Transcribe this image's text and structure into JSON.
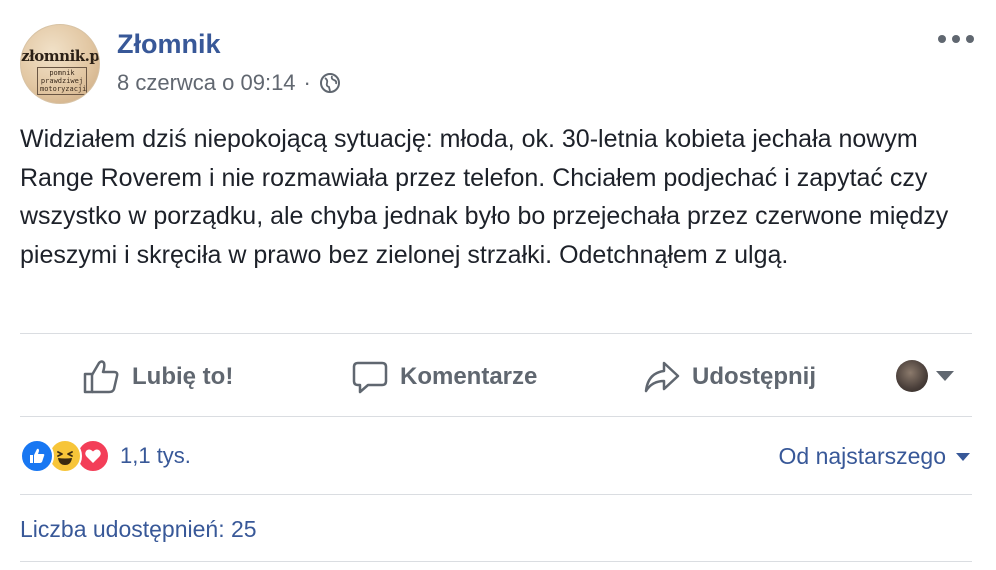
{
  "post": {
    "author": "Złomnik",
    "avatar_logo_text": "złomnik.pl",
    "avatar_logo_sub": "pomnik prawdziwej motoryzacji",
    "timestamp": "8 czerwca o 09:14",
    "separator": "·",
    "privacy_icon": "globe-icon",
    "more_icon": "more-options-icon",
    "text": "Widziałem dziś niepokojącą sytuację: młoda, ok. 30-letnia kobieta jechała nowym Range Roverem i nie rozmawiała przez telefon. Chciałem podjechać i zapytać czy wszystko w porządku, ale chyba jednak było bo przejechała przez czerwone między pieszymi i skręciła w prawo bez zielonej strzałki. Odetchnąłem z ulgą."
  },
  "actions": {
    "like": "Lubię to!",
    "comment": "Komentarze",
    "share": "Udostępnij"
  },
  "reactions": {
    "types": [
      "like",
      "haha",
      "love"
    ],
    "count": "1,1 tys."
  },
  "comments": {
    "sort_label": "Od najstarszego"
  },
  "shares": {
    "label": "Liczba udostępnień: 25"
  },
  "colors": {
    "link_blue": "#385898",
    "meta_gray": "#616770",
    "divider": "#dadde1",
    "like_blue": "#1877f2",
    "haha_yellow": "#f7c539",
    "love_red": "#f33e58"
  }
}
